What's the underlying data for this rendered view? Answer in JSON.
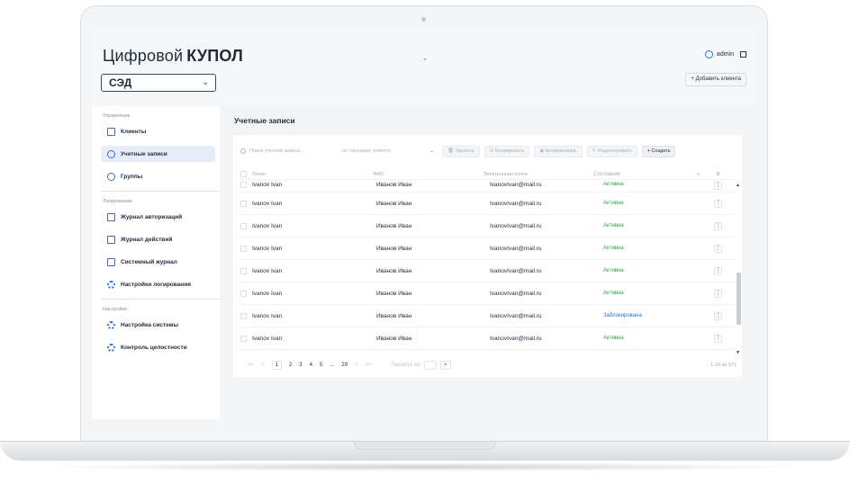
{
  "brand": {
    "light": "Цифровой",
    "bold": "КУПОЛ"
  },
  "system_select": {
    "value": "СЭД"
  },
  "user": {
    "name": "admin"
  },
  "add_client_label": "+ Добавить клиента",
  "sidebar": {
    "sections": [
      {
        "title": "Управление",
        "items": [
          {
            "label": "Клиенты",
            "icon": "home-icon",
            "active": false
          },
          {
            "label": "Учетные записи",
            "icon": "user-icon",
            "active": true
          },
          {
            "label": "Группы",
            "icon": "globe-icon",
            "active": false
          }
        ]
      },
      {
        "title": "Логирование",
        "items": [
          {
            "label": "Журнал авторизаций",
            "icon": "doc-icon",
            "active": false
          },
          {
            "label": "Журнал действий",
            "icon": "doc-icon",
            "active": false
          },
          {
            "label": "Системный журнал",
            "icon": "doc-icon",
            "active": false
          },
          {
            "label": "Настройки логирования",
            "icon": "gear-icon",
            "active": false
          }
        ]
      },
      {
        "title": "Настройки",
        "items": [
          {
            "label": "Настройка системы",
            "icon": "gear-icon",
            "active": false
          },
          {
            "label": "Контроль целостности",
            "icon": "gear-icon",
            "active": false
          }
        ]
      }
    ]
  },
  "page_title": "Учетные записи",
  "toolbar": {
    "search_placeholder": "Поиск учетной записи...",
    "scope": "по текущему клиенту",
    "delete": "Удалить",
    "block": "Блокировать",
    "activate": "Активировать",
    "edit": "Редактировать",
    "create": "+ Создать"
  },
  "table": {
    "headers": {
      "login": "Логин",
      "fio": "ФИО",
      "email": "Электронная почта",
      "status": "Состояние"
    },
    "rows": [
      {
        "login": "Ivanov Ivan",
        "fio": "Иванов Иван",
        "email": "IvanovIvan@mail.ru",
        "status": "Активна",
        "status_type": "active"
      },
      {
        "login": "Ivanov Ivan",
        "fio": "Иванов Иван",
        "email": "IvanovIvan@mail.ru",
        "status": "Активна",
        "status_type": "active"
      },
      {
        "login": "Ivanov Ivan",
        "fio": "Иванов Иван",
        "email": "IvanovIvan@mail.ru",
        "status": "Активна",
        "status_type": "active"
      },
      {
        "login": "Ivanov Ivan",
        "fio": "Иванов Иван",
        "email": "IvanovIvan@mail.ru",
        "status": "Активна",
        "status_type": "active"
      },
      {
        "login": "Ivanov Ivan",
        "fio": "Иванов Иван",
        "email": "IvanovIvan@mail.ru",
        "status": "Активна",
        "status_type": "active"
      },
      {
        "login": "Ivanov Ivan",
        "fio": "Иванов Иван",
        "email": "IvanovIvan@mail.ru",
        "status": "Активна",
        "status_type": "active"
      },
      {
        "login": "Ivanov Ivan",
        "fio": "Иванов Иван",
        "email": "IvanovIvan@mail.ru",
        "status": "Заблокирована",
        "status_type": "blocked"
      },
      {
        "login": "Ivanov Ivan",
        "fio": "Иванов Иван",
        "email": "IvanovIvan@mail.ru",
        "status": "Активна",
        "status_type": "active"
      }
    ]
  },
  "pagination": {
    "first": "<<",
    "prev": "<",
    "pages": [
      "1",
      "2",
      "3",
      "4",
      "5",
      "...",
      "29"
    ],
    "current": "1",
    "next": ">",
    "last": ">>",
    "goto_label": "Перейти на",
    "goto_arrow": ">",
    "total": "1-20 из 571"
  },
  "colors": {
    "accent": "#2f6fd1",
    "active_status": "#2f9b50",
    "blocked_status": "#2f6fd1"
  }
}
